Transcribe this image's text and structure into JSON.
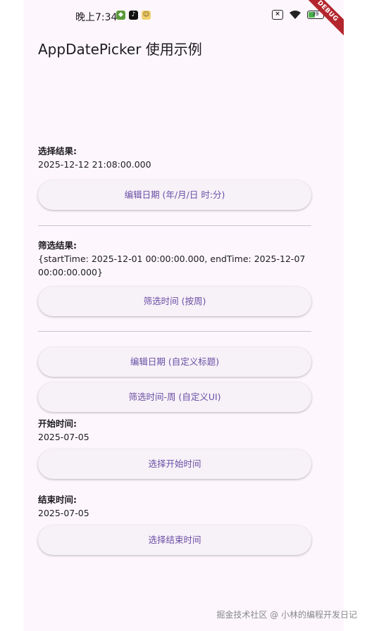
{
  "status_bar": {
    "time": "晚上7:34",
    "app_icons": [
      "app-icon-green",
      "tiktok-icon",
      "face-icon"
    ],
    "battery_level": "39",
    "battery_fraction": 0.39,
    "debug_label": "DEBUG"
  },
  "app_bar": {
    "title": "AppDatePicker 使用示例"
  },
  "section_select": {
    "label": "选择结果:",
    "value": "2025-12-12 21:08:00.000",
    "button_label": "编辑日期 (年/月/日 时:分)"
  },
  "section_filter": {
    "label": "筛选结果:",
    "value": "{startTime: 2025-12-01 00:00:00.000, endTime: 2025-12-07 00:00:00.000}",
    "button_label": "筛选时间 (按周)"
  },
  "section_custom": {
    "edit_button_label": "编辑日期 (自定义标题)",
    "filter_button_label": "筛选时间-周 (自定义UI)"
  },
  "section_start": {
    "label": "开始时间:",
    "value": "2025-07-05",
    "button_label": "选择开始时间"
  },
  "section_end": {
    "label": "结束时间:",
    "value": "2025-07-05",
    "button_label": "选择结束时间"
  },
  "watermark": "掘金技术社区 @ 小林的编程开发日记",
  "colors": {
    "background": "#fdf7fd",
    "button_bg": "#f7f1f8",
    "button_text": "#6750a4",
    "divider": "#cac4d0",
    "debug_banner": "#b3262d"
  }
}
